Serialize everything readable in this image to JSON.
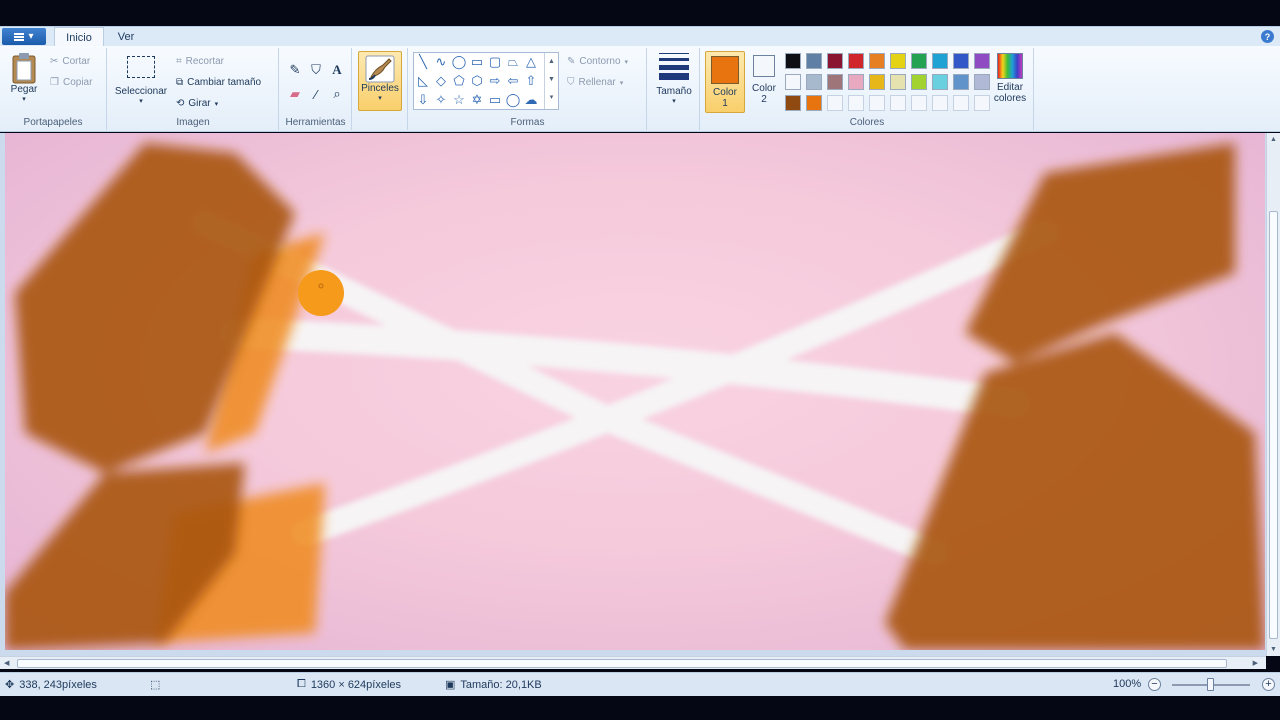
{
  "tabs": {
    "app_menu": "▾",
    "inicio": "Inicio",
    "ver": "Ver",
    "help": "?"
  },
  "ribbon": {
    "portapapeles": {
      "label": "Portapapeles",
      "pegar": "Pegar",
      "cortar": "Cortar",
      "copiar": "Copiar"
    },
    "imagen": {
      "label": "Imagen",
      "seleccionar": "Seleccionar",
      "recortar": "Recortar",
      "cambiar_tamano": "Cambiar tamaño",
      "girar": "Girar"
    },
    "herramientas": {
      "label": "Herramientas",
      "text_tool": "A"
    },
    "pinceles": {
      "label": "Pinceles"
    },
    "formas": {
      "label": "Formas",
      "contorno": "Contorno",
      "rellenar": "Rellenar"
    },
    "tamano": {
      "label": "Tamaño"
    },
    "colores": {
      "label": "Colores",
      "color1_line1": "Color",
      "color1_line2": "1",
      "color2_line1": "Color",
      "color2_line2": "2",
      "editar_line1": "Editar",
      "editar_line2": "colores",
      "color1": "#e8740f",
      "color2": "#f4f7fb",
      "row1": [
        "#0e0f14",
        "#5f7fa4",
        "#8a1530",
        "#d0262b",
        "#e57f22",
        "#e4d214",
        "#23a351",
        "#1ea2d3",
        "#3258c8",
        "#8f4cc2"
      ],
      "row2": [
        "#f4f7fb",
        "#a7b9cc",
        "#9e7579",
        "#e8a8c0",
        "#e7b619",
        "#e6e2b0",
        "#a2d22f",
        "#69d0e0",
        "#5f93c9",
        "#b0b9d6"
      ],
      "row3": [
        "#8f4a12",
        "#e8740f"
      ]
    }
  },
  "status": {
    "cursor": "338, 243píxeles",
    "dimensions": "1360 × 624píxeles",
    "size": "Tamaño: 20,1KB",
    "zoom": "100%"
  }
}
